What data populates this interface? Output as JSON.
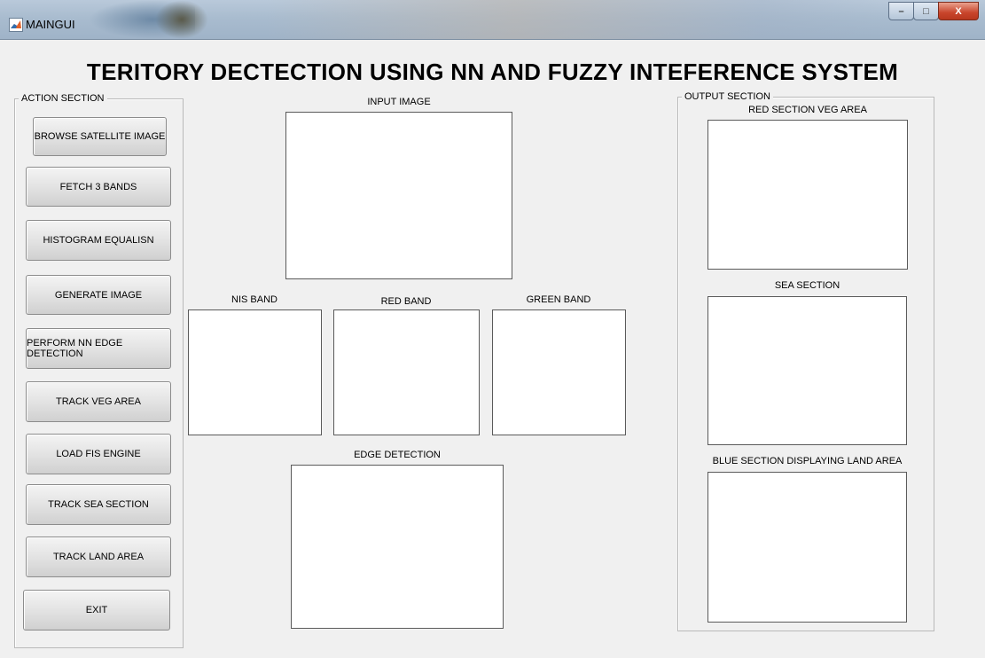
{
  "window": {
    "title": "MAINGUI",
    "buttons": {
      "minimize": "–",
      "maximize": "□",
      "close": "X"
    }
  },
  "heading": "TERITORY DECTECTION USING NN AND FUZZY INTEFERENCE SYSTEM",
  "action_section": {
    "title": "ACTION SECTION",
    "buttons": [
      "BROWSE SATELLITE IMAGE",
      "FETCH 3 BANDS",
      "HISTOGRAM EQUALISN",
      "GENERATE IMAGE",
      "PERFORM NN EDGE DETECTION",
      "TRACK VEG AREA",
      "LOAD FIS ENGINE",
      "TRACK SEA SECTION",
      "TRACK LAND AREA",
      "EXIT"
    ]
  },
  "center": {
    "input_image": "INPUT IMAGE",
    "nis_band": "NIS BAND",
    "red_band": "RED BAND",
    "green_band": "GREEN BAND",
    "edge_detection": "EDGE DETECTION"
  },
  "output_section": {
    "title": "OUTPUT SECTION",
    "red_section": "RED SECTION VEG AREA",
    "sea_section": "SEA SECTION",
    "blue_section": "BLUE SECTION DISPLAYING LAND AREA"
  },
  "icons": {
    "app": "matlab-icon"
  }
}
